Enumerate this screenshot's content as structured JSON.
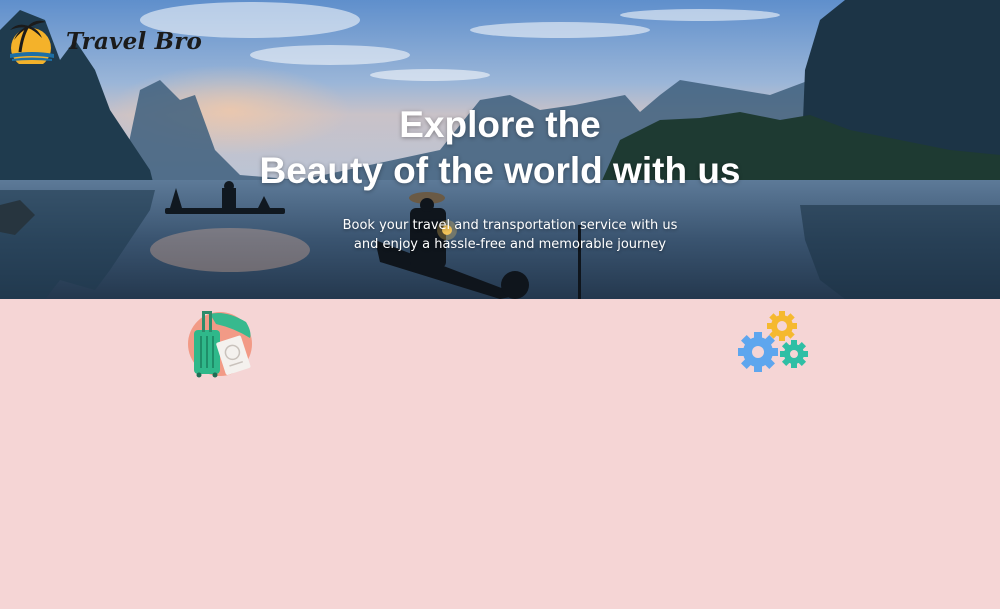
{
  "brand": {
    "name": "Travel Bro",
    "logo_icon": "palm-sunset-icon"
  },
  "hero": {
    "title_line1": "Explore the",
    "title_line2": "Beauty of the world with us",
    "subtitle_line1": "Book your travel and transportation service with us",
    "subtitle_line2": "and enjoy a hassle-free and memorable journey"
  },
  "features": [
    {
      "icon": "luggage-passport-icon"
    },
    {
      "icon": "gears-icon"
    }
  ],
  "colors": {
    "page_background": "#f5d5d5",
    "hero_text": "#ffffff",
    "logo_text": "#1b1b1b",
    "sun": "#f4b22a",
    "gear_blue": "#5ea6ee",
    "gear_yellow": "#f5b92f",
    "gear_teal": "#2ebfa5",
    "luggage_green": "#2fb88a"
  }
}
